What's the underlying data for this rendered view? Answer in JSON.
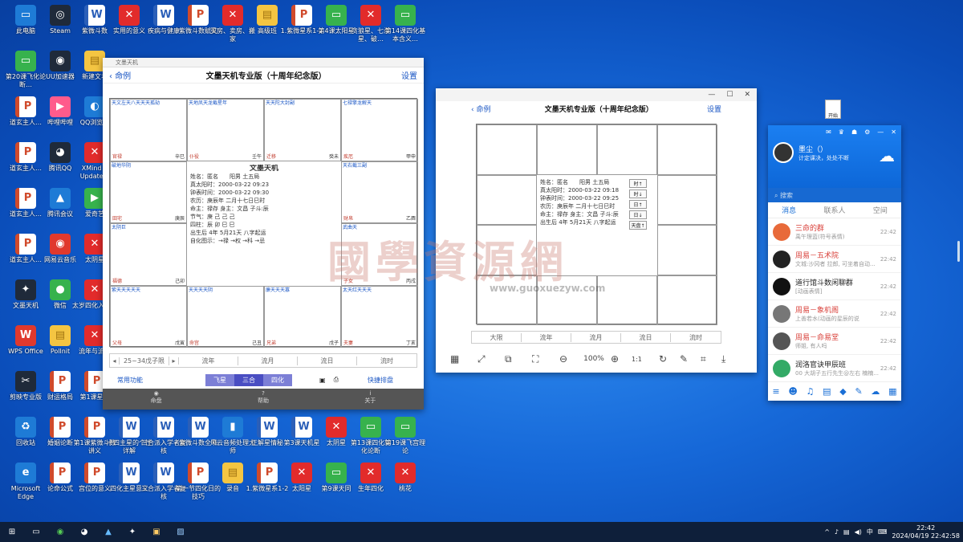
{
  "desktop_icons": [
    {
      "label": "此电脑",
      "kind": "blue",
      "glyph": "▭",
      "col": 0,
      "row": 0
    },
    {
      "label": "Steam",
      "kind": "app",
      "glyph": "◎",
      "col": 1,
      "row": 0
    },
    {
      "label": "紫微斗数",
      "kind": "word",
      "glyph": "W",
      "col": 2,
      "row": 0
    },
    {
      "label": "实用的意义",
      "kind": "xmind",
      "glyph": "✕",
      "col": 3,
      "row": 0
    },
    {
      "label": "疾病与健康",
      "kind": "word",
      "glyph": "W",
      "col": 4,
      "row": 0
    },
    {
      "label": "紫微斗数赋文",
      "kind": "ppt",
      "glyph": "P",
      "col": 5,
      "row": 0
    },
    {
      "label": "买房、卖房、搬家",
      "kind": "xmind",
      "glyph": "✕",
      "col": 6,
      "row": 0
    },
    {
      "label": "高级班",
      "kind": "folder",
      "glyph": "▤",
      "col": 7,
      "row": 0
    },
    {
      "label": "1.紫微星系1-2",
      "kind": "ppt",
      "glyph": "P",
      "col": 8,
      "row": 0
    },
    {
      "label": "第4课太阳星",
      "kind": "green",
      "glyph": "▭",
      "col": 9,
      "row": 0
    },
    {
      "label": "贪狼星、七杀星、破…",
      "kind": "xmind",
      "glyph": "✕",
      "col": 10,
      "row": 0
    },
    {
      "label": "第14课四化基本含义…",
      "kind": "green",
      "glyph": "▭",
      "col": 11,
      "row": 0
    },
    {
      "label": "第20课飞化论断…",
      "kind": "green",
      "glyph": "▭",
      "col": 0,
      "row": 1
    },
    {
      "label": "UU加速器",
      "kind": "app",
      "glyph": "◉",
      "col": 1,
      "row": 1
    },
    {
      "label": "新建文本",
      "kind": "folder",
      "glyph": "▤",
      "col": 2,
      "row": 1
    },
    {
      "label": "道玄主人…",
      "kind": "ppt",
      "glyph": "P",
      "col": 0,
      "row": 2
    },
    {
      "label": "哔哩哔哩",
      "kind": "pink",
      "glyph": "▶",
      "col": 1,
      "row": 2
    },
    {
      "label": "QQ浏览器",
      "kind": "blue",
      "glyph": "◐",
      "col": 2,
      "row": 2
    },
    {
      "label": "道玄主人…",
      "kind": "ppt",
      "glyph": "P",
      "col": 0,
      "row": 3
    },
    {
      "label": "腾讯QQ",
      "kind": "app",
      "glyph": "◕",
      "col": 1,
      "row": 3
    },
    {
      "label": "XMind 8 Update 9",
      "kind": "xmind",
      "glyph": "✕",
      "col": 2,
      "row": 3
    },
    {
      "label": "道玄主人…",
      "kind": "ppt",
      "glyph": "P",
      "col": 0,
      "row": 4
    },
    {
      "label": "腾讯会议",
      "kind": "blue",
      "glyph": "▲",
      "col": 1,
      "row": 4
    },
    {
      "label": "爱奇艺",
      "kind": "green",
      "glyph": "▶",
      "col": 2,
      "row": 4
    },
    {
      "label": "道玄主人…",
      "kind": "ppt",
      "glyph": "P",
      "col": 0,
      "row": 5
    },
    {
      "label": "网易云音乐",
      "kind": "red",
      "glyph": "◉",
      "col": 1,
      "row": 5
    },
    {
      "label": "太阴星",
      "kind": "xmind",
      "glyph": "✕",
      "col": 2,
      "row": 5
    },
    {
      "label": "文墨天机",
      "kind": "app",
      "glyph": "✦",
      "col": 0,
      "row": 6
    },
    {
      "label": "微信",
      "kind": "green",
      "glyph": "●",
      "col": 1,
      "row": 6
    },
    {
      "label": "太岁四化入本宫",
      "kind": "xmind",
      "glyph": "✕",
      "col": 2,
      "row": 6
    },
    {
      "label": "WPS Office",
      "kind": "red",
      "glyph": "W",
      "col": 0,
      "row": 7
    },
    {
      "label": "Pollnit",
      "kind": "folder",
      "glyph": "▤",
      "col": 1,
      "row": 7
    },
    {
      "label": "流年与流运",
      "kind": "xmind",
      "glyph": "✕",
      "col": 2,
      "row": 7
    },
    {
      "label": "剪映专业版",
      "kind": "app",
      "glyph": "✂",
      "col": 0,
      "row": 8
    },
    {
      "label": "财运格局",
      "kind": "ppt",
      "glyph": "P",
      "col": 1,
      "row": 8
    },
    {
      "label": "第1课星曜",
      "kind": "ppt",
      "glyph": "P",
      "col": 2,
      "row": 8
    },
    {
      "label": "回收站",
      "kind": "blue",
      "glyph": "♻",
      "col": 0,
      "row": 9
    },
    {
      "label": "婚姻论断",
      "kind": "ppt",
      "glyph": "P",
      "col": 1,
      "row": 9
    },
    {
      "label": "第1课紫微斗数讲义",
      "kind": "ppt",
      "glyph": "P",
      "col": 2,
      "row": 9
    },
    {
      "label": "十四主星的个性详解",
      "kind": "word",
      "glyph": "W",
      "col": 3,
      "row": 9
    },
    {
      "label": "三合派入学者复核",
      "kind": "word",
      "glyph": "W",
      "col": 4,
      "row": 9
    },
    {
      "label": "紫微斗数全书",
      "kind": "word",
      "glyph": "W",
      "col": 5,
      "row": 9
    },
    {
      "label": "风云音频处理大师",
      "kind": "blue",
      "glyph": "▮",
      "col": 6,
      "row": 9
    },
    {
      "label": "正解星情秘",
      "kind": "word",
      "glyph": "W",
      "col": 7,
      "row": 9
    },
    {
      "label": "第3课天机星",
      "kind": "word",
      "glyph": "W",
      "col": 8,
      "row": 9
    },
    {
      "label": "太阴星",
      "kind": "xmind",
      "glyph": "✕",
      "col": 9,
      "row": 9
    },
    {
      "label": "第13课四化转化论断",
      "kind": "green",
      "glyph": "▭",
      "col": 10,
      "row": 9
    },
    {
      "label": "第19课飞宫理论",
      "kind": "green",
      "glyph": "▭",
      "col": 11,
      "row": 9
    },
    {
      "label": "Microsoft Edge",
      "kind": "blue",
      "glyph": "e",
      "col": 0,
      "row": 10
    },
    {
      "label": "论命公式",
      "kind": "ppt",
      "glyph": "P",
      "col": 1,
      "row": 10
    },
    {
      "label": "宫位的意义",
      "kind": "ppt",
      "glyph": "P",
      "col": 2,
      "row": 10
    },
    {
      "label": "四化主星意义",
      "kind": "word",
      "glyph": "W",
      "col": 3,
      "row": 10
    },
    {
      "label": "三合派入学者复核",
      "kind": "word",
      "glyph": "W",
      "col": 4,
      "row": 10
    },
    {
      "label": "第一节四化日的技巧",
      "kind": "ppt",
      "glyph": "P",
      "col": 5,
      "row": 10
    },
    {
      "label": "录音",
      "kind": "folder",
      "glyph": "▤",
      "col": 6,
      "row": 10
    },
    {
      "label": "1.紫微星系1-2",
      "kind": "ppt",
      "glyph": "P",
      "col": 7,
      "row": 10
    },
    {
      "label": "太阳星",
      "kind": "xmind",
      "glyph": "✕",
      "col": 8,
      "row": 10
    },
    {
      "label": "第9课天同",
      "kind": "green",
      "glyph": "▭",
      "col": 9,
      "row": 10
    },
    {
      "label": "生年四化",
      "kind": "xmind",
      "glyph": "✕",
      "col": 10,
      "row": 10
    },
    {
      "label": "桃花",
      "kind": "xmind",
      "glyph": "✕",
      "col": 11,
      "row": 10
    }
  ],
  "win1": {
    "title": "文墨天机",
    "back": "命例",
    "header": "文墨天机专业版（十周年纪念版）",
    "settings": "设置",
    "center_title": "文墨天机",
    "center_lines": [
      "姓名：匿名　　阳男 土五局",
      "真太阳时：2000-03-22 09:23",
      "钟表时间：2000-03-22 09:30",
      "农历：庚辰年 二月十七日巳时",
      "命主：禄存 身主：文昌 子斗:辰",
      "节气：庚 己 己 己",
      "四柱：辰 卯 巳 巳",
      "出生后 4年 5月21天 八字起运",
      "自化图示：→禄 →权 →科 →忌"
    ],
    "cells": [
      {
        "stars": "天文左天八天天天孤劫",
        "gz": "辛巳",
        "name": "官禄"
      },
      {
        "stars": "天地凤天龙截星年",
        "gz": "壬午",
        "name": "仆役"
      },
      {
        "stars": "天天陀大封副",
        "gz": "癸未",
        "name": "迁移"
      },
      {
        "stars": "七禄擎龙解天",
        "gz": "甲申",
        "name": "疾厄"
      },
      {
        "stars": "破地华阴",
        "gz": "庚辰",
        "name": "田宅"
      },
      {
        "stars": "天右截三副",
        "gz": "乙酉",
        "name": "财帛"
      },
      {
        "stars": "太阴巨",
        "gz": "己卯",
        "name": "福德"
      },
      {
        "stars": "武曲天",
        "gz": "丙戌",
        "name": "子女"
      },
      {
        "stars": "紫天天天天天",
        "gz": "戊寅",
        "name": "父母"
      },
      {
        "stars": "天天天天阴",
        "gz": "己丑",
        "name": "命宫"
      },
      {
        "stars": "廉天天天寡",
        "gz": "戊子",
        "name": "兄弟"
      },
      {
        "stars": "太天红天天天",
        "gz": "丁亥",
        "name": "夫妻"
      }
    ],
    "range_label": "25~34戊子限",
    "toolbar": [
      "流年",
      "流月",
      "流日",
      "流时"
    ],
    "func": "常用功能",
    "tabs": [
      "飞星",
      "三合",
      "四化"
    ],
    "quick": "快捷排盘",
    "bottom": [
      {
        "label": "命盘",
        "icon": "chart-icon"
      },
      {
        "label": "帮助",
        "icon": "help-icon"
      },
      {
        "label": "关于",
        "icon": "info-icon"
      }
    ]
  },
  "win2": {
    "back": "命例",
    "header": "文墨天机专业版（十周年纪念版）",
    "settings": "设置",
    "center_lines": [
      "姓名：匿名　　阳男 土五局",
      "真太阳时：2000-03-22 09:18",
      "钟表时间：2000-03-22 09:25",
      "农历：庚辰年 二月十七日巳时",
      "命主：禄存 身主：文昌 子斗:辰",
      "出生后 4年 5月21天 八字起运"
    ],
    "side_buttons": [
      "时↑",
      "时↓",
      "日↑",
      "日↓",
      "天盘↑"
    ],
    "toolbar": [
      "大限",
      "流年",
      "流月",
      "流日",
      "流时"
    ],
    "zoom": "100%"
  },
  "qq": {
    "name": "墨尘（）",
    "sig": "计定课决，处处不断",
    "search": "搜索",
    "tabs": [
      "消息",
      "联系人",
      "空间"
    ],
    "chats": [
      {
        "name": "三命的群",
        "msg": "禹午理蓝(符号表情)",
        "time": "22:42",
        "red": true,
        "color": "#e86a3a"
      },
      {
        "name": "周易－五术院",
        "msg": "文城:沙冈者 拉郎, 可坐着自动...",
        "time": "22:42",
        "red": true,
        "color": "#222"
      },
      {
        "name": "道行馆斗数闲聊群",
        "msg": "[动画表情]",
        "time": "22:42",
        "red": false,
        "color": "#111"
      },
      {
        "name": "周易－象机阁",
        "msg": "上善若水(动画的星辰的说",
        "time": "22:42",
        "red": true,
        "color": "#777"
      },
      {
        "name": "周易－命易堂",
        "msg": "师姐, 有人吗",
        "time": "22:42",
        "red": true,
        "color": "#555"
      },
      {
        "name": "润洛官诀甲辰班",
        "msg": "00 大胡子五行先生@左右 楠楠...",
        "time": "22:42",
        "red": false,
        "color": "#3a6"
      }
    ]
  },
  "mini_button": "开始",
  "watermark": {
    "text": "國學資源網",
    "url": "www.guoxuezyw.com"
  },
  "taskbar": {
    "time": "22:42",
    "datetime": "2024/04/19 22:42:58",
    "ime": "中"
  }
}
